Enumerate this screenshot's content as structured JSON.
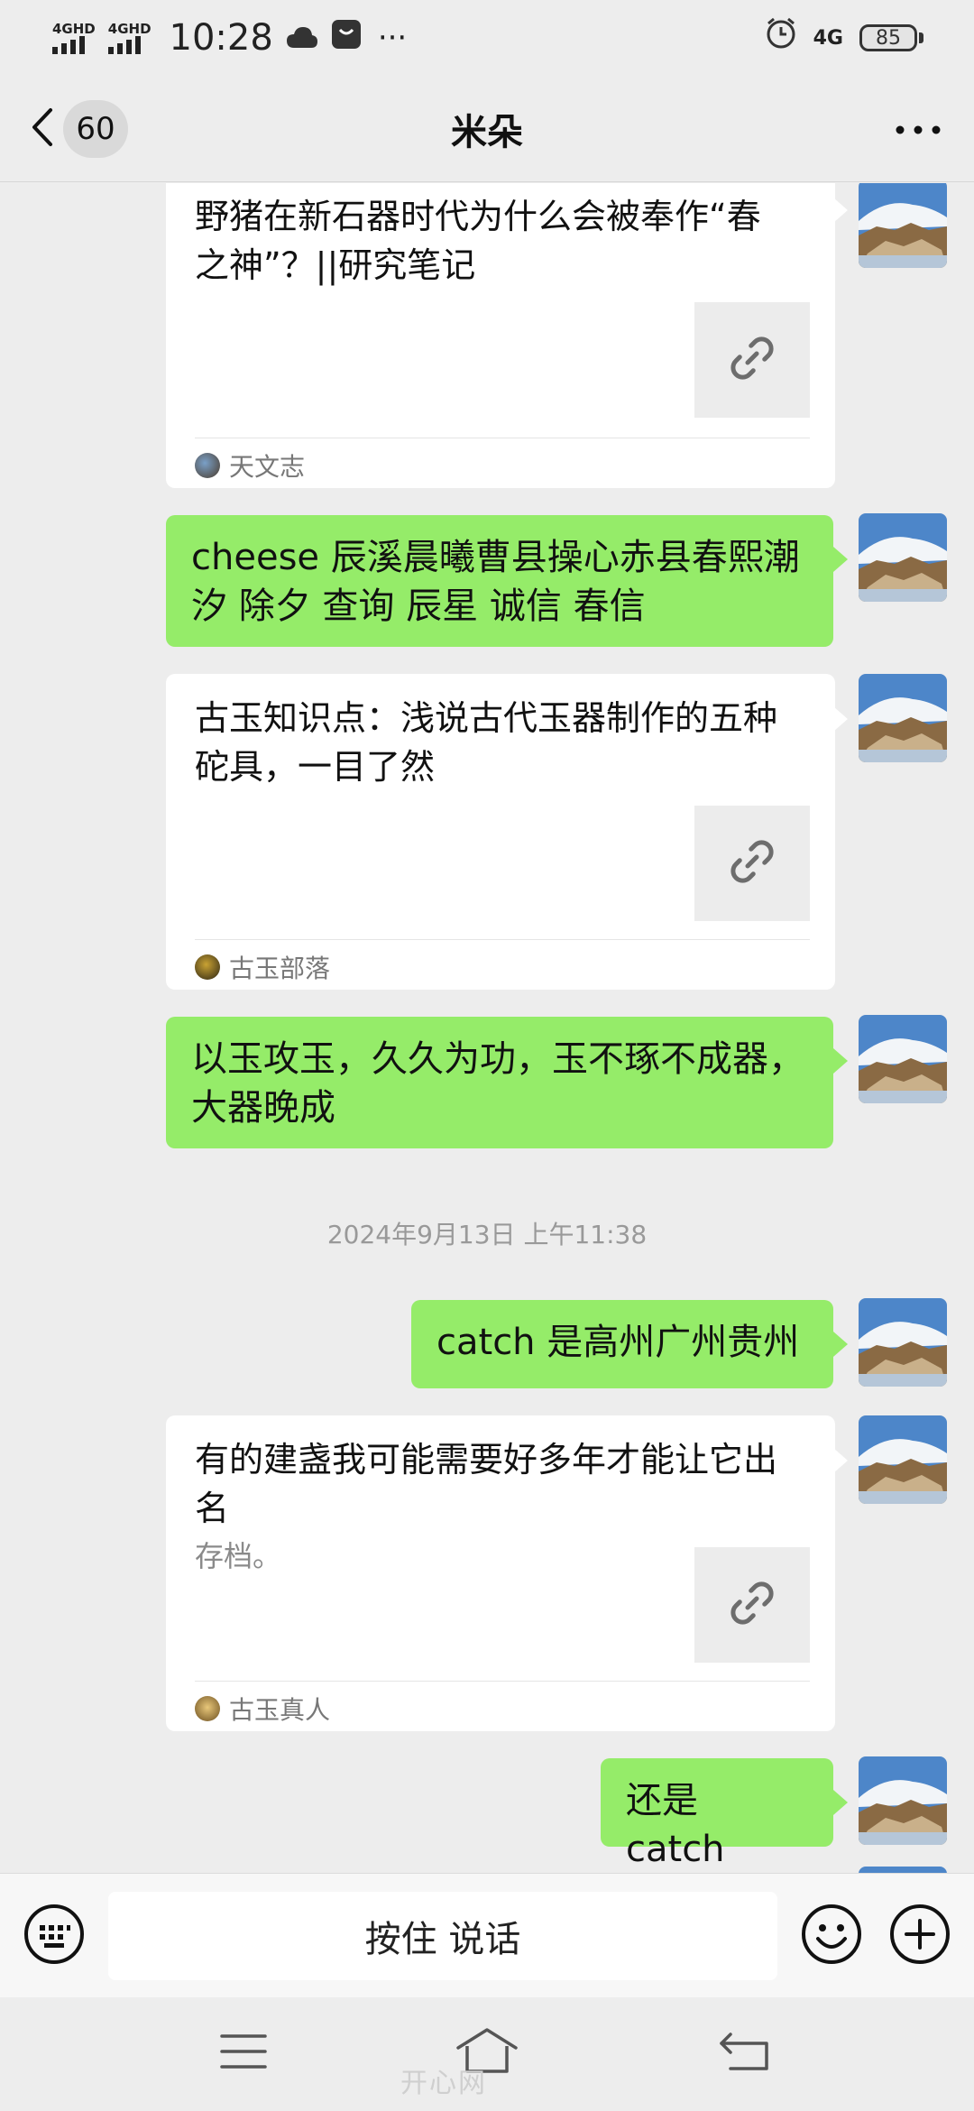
{
  "status_bar": {
    "signal_1": "4GHD",
    "signal_2": "4GHD",
    "time": "10:28",
    "more": "···",
    "network": "4G",
    "battery": "85"
  },
  "nav": {
    "back_count": "60",
    "title": "米朵"
  },
  "messages": {
    "card_1": {
      "title": "野猪在新石器时代为什么会被奉作“春之神”？||研究笔记",
      "source": "天文志"
    },
    "text_1": "cheese 辰溪晨曦曹县操心赤县春熙潮汐 除夕 查询 辰星 诚信 春信",
    "card_2": {
      "title": "古玉知识点：浅说古代玉器制作的五种砣具，一目了然",
      "source": "古玉部落"
    },
    "text_2": "以玉攻玉，久久为功，玉不琢不成器，大器晚成",
    "timestamp": "2024年9月13日 上午11:38",
    "text_3": "catch 是高州广州贵州",
    "card_3": {
      "title": "有的建盏我可能需要好多年才能让它出名",
      "desc": "存档。",
      "source": "古玉真人"
    },
    "text_4": "还是 catch"
  },
  "input_bar": {
    "hold_to_talk": "按住 说话"
  },
  "colors": {
    "bubble_green": "#95ec69",
    "background": "#ededed",
    "card": "#ffffff"
  },
  "watermark": "开心网"
}
